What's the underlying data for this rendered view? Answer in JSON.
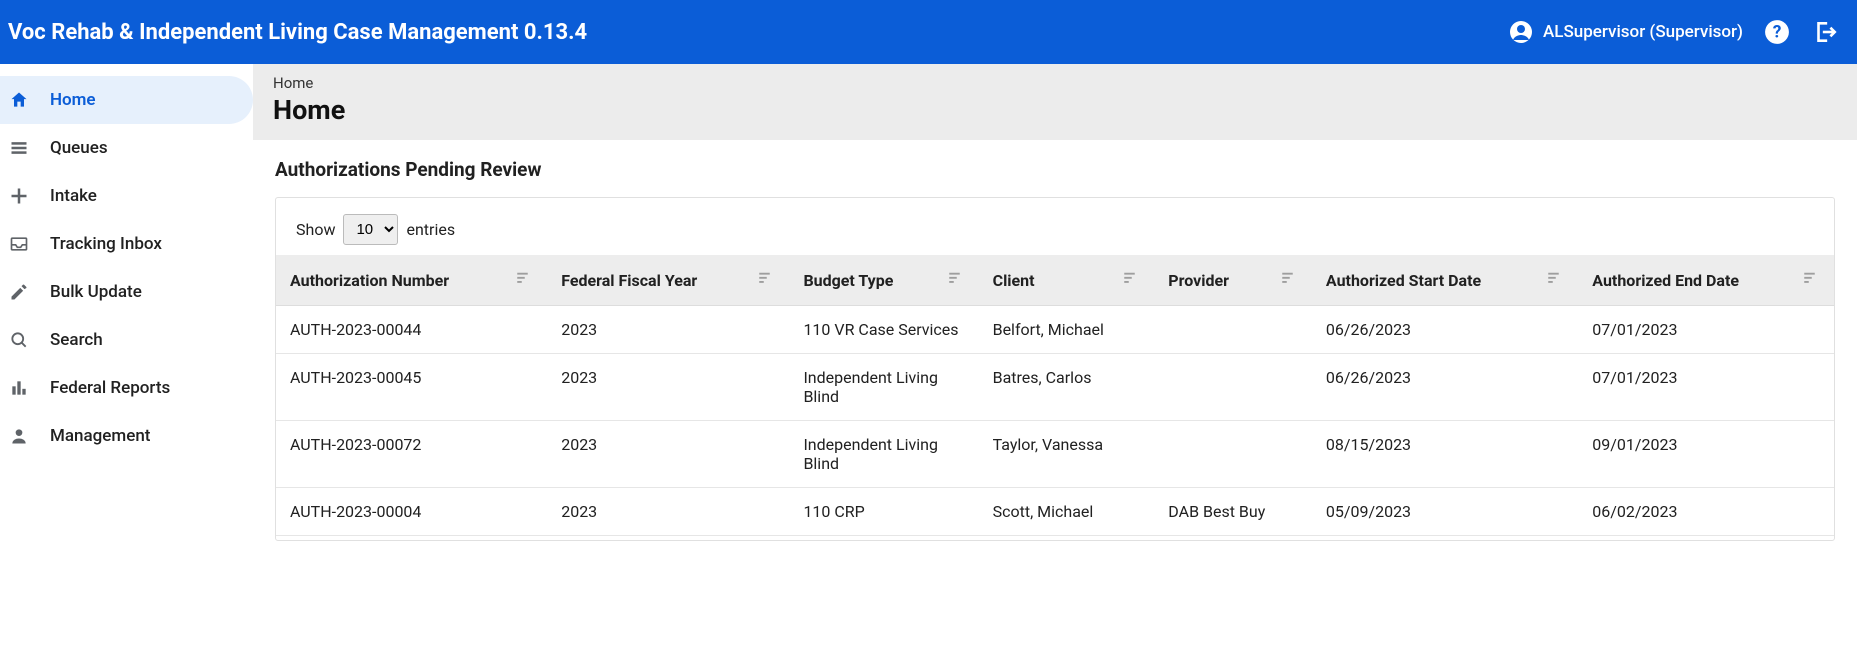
{
  "header": {
    "app_title": "Voc Rehab & Independent Living Case Management 0.13.4",
    "user_label": "ALSupervisor (Supervisor)"
  },
  "sidebar": {
    "items": [
      {
        "label": "Home",
        "icon": "home",
        "active": true
      },
      {
        "label": "Queues",
        "icon": "list",
        "active": false
      },
      {
        "label": "Intake",
        "icon": "plus",
        "active": false
      },
      {
        "label": "Tracking Inbox",
        "icon": "inbox",
        "active": false
      },
      {
        "label": "Bulk Update",
        "icon": "edit",
        "active": false
      },
      {
        "label": "Search",
        "icon": "search",
        "active": false
      },
      {
        "label": "Federal Reports",
        "icon": "bar",
        "active": false
      },
      {
        "label": "Management",
        "icon": "person",
        "active": false
      }
    ]
  },
  "page": {
    "breadcrumb": "Home",
    "title": "Home"
  },
  "panel": {
    "title": "Authorizations Pending Review",
    "show_label_pre": "Show",
    "show_label_post": "entries",
    "page_size": "10"
  },
  "table": {
    "columns": [
      "Authorization Number",
      "Federal Fiscal Year",
      "Budget Type",
      "Client",
      "Provider",
      "Authorized Start Date",
      "Authorized End Date"
    ],
    "rows": [
      {
        "auth_no": "AUTH-2023-00044",
        "fy": "2023",
        "budget_type": "110 VR Case Services",
        "client": "Belfort, Michael",
        "provider": "",
        "start": "06/26/2023",
        "end": "07/01/2023"
      },
      {
        "auth_no": "AUTH-2023-00045",
        "fy": "2023",
        "budget_type": "Independent Living Blind",
        "client": "Batres, Carlos",
        "provider": "",
        "start": "06/26/2023",
        "end": "07/01/2023"
      },
      {
        "auth_no": "AUTH-2023-00072",
        "fy": "2023",
        "budget_type": "Independent Living Blind",
        "client": "Taylor, Vanessa",
        "provider": "",
        "start": "08/15/2023",
        "end": "09/01/2023"
      },
      {
        "auth_no": "AUTH-2023-00004",
        "fy": "2023",
        "budget_type": "110 CRP",
        "client": "Scott, Michael",
        "provider": "DAB Best Buy",
        "start": "05/09/2023",
        "end": "06/02/2023"
      }
    ]
  }
}
